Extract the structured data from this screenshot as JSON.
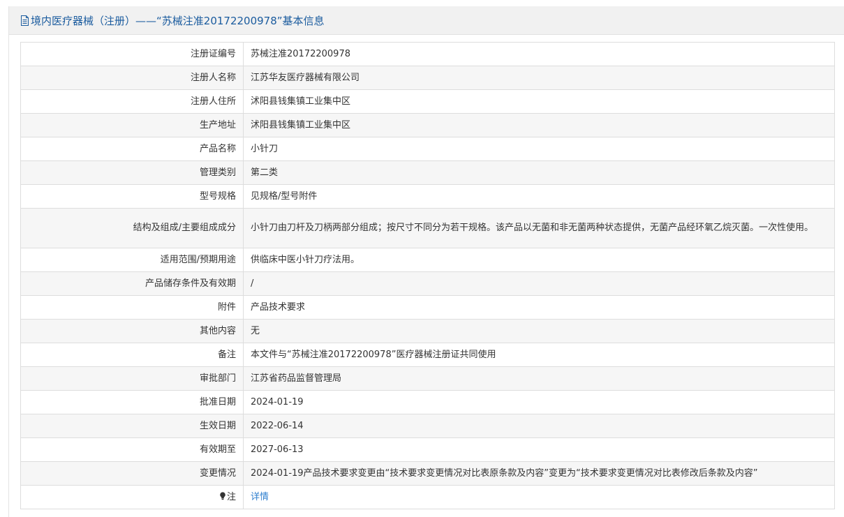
{
  "header": {
    "title": "境内医疗器械（注册）——“苏械注准20172200978”基本信息",
    "icon": "document-icon"
  },
  "rows": [
    {
      "label": "注册证编号",
      "value": "苏械注准20172200978"
    },
    {
      "label": "注册人名称",
      "value": "江苏华友医疗器械有限公司"
    },
    {
      "label": "注册人住所",
      "value": "沭阳县钱集镇工业集中区"
    },
    {
      "label": "生产地址",
      "value": "沭阳县钱集镇工业集中区"
    },
    {
      "label": "产品名称",
      "value": "小针刀"
    },
    {
      "label": "管理类别",
      "value": "第二类"
    },
    {
      "label": "型号规格",
      "value": "见规格/型号附件"
    },
    {
      "label": "结构及组成/主要组成成分",
      "value": "小针刀由刀杆及刀柄两部分组成；按尺寸不同分为若干规格。该产品以无菌和非无菌两种状态提供，无菌产品经环氧乙烷灭菌。一次性使用。"
    },
    {
      "label": "适用范围/预期用途",
      "value": "供临床中医小针刀疗法用。"
    },
    {
      "label": "产品储存条件及有效期",
      "value": "/"
    },
    {
      "label": "附件",
      "value": "产品技术要求"
    },
    {
      "label": "其他内容",
      "value": "无"
    },
    {
      "label": "备注",
      "value": "本文件与“苏械注准20172200978”医疗器械注册证共同使用"
    },
    {
      "label": "审批部门",
      "value": "江苏省药品监督管理局"
    },
    {
      "label": "批准日期",
      "value": "2024-01-19"
    },
    {
      "label": "生效日期",
      "value": "2022-06-14"
    },
    {
      "label": "有效期至",
      "value": "2027-06-13"
    },
    {
      "label": "变更情况",
      "value": "2024-01-19产品技术要求变更由“技术要求变更情况对比表原条款及内容”变更为“技术要求变更情况对比表修改后条款及内容”"
    },
    {
      "label": "注",
      "value": "详情",
      "icon": "lightbulb-icon"
    }
  ],
  "colors": {
    "header_text": "#1a5b9e",
    "header_bg": "#f1f1f1",
    "link": "#2f7fcf",
    "stripe": "#f6f6f6",
    "border": "#dddddd"
  }
}
